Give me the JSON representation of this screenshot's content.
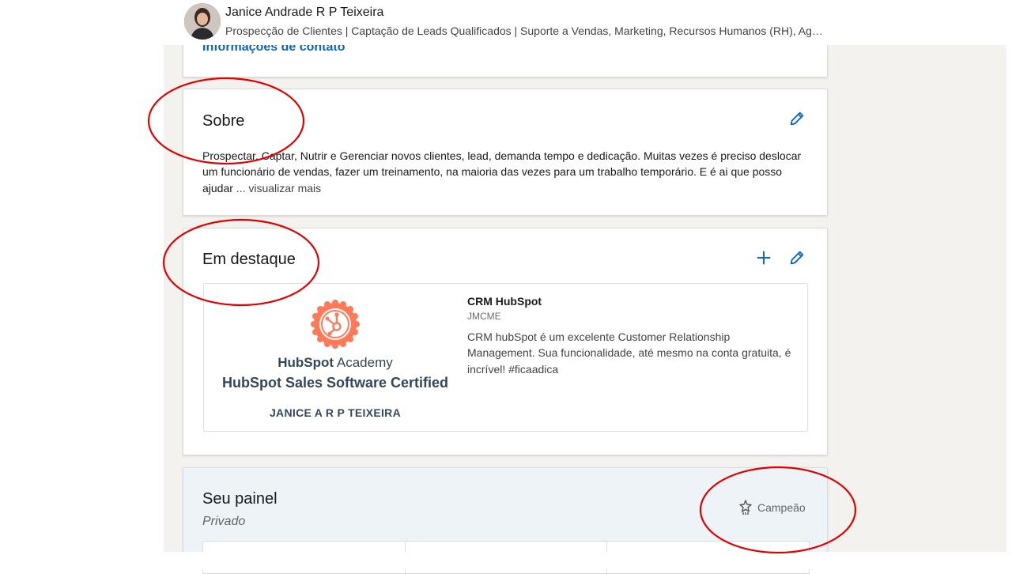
{
  "header": {
    "name": "Janice Andrade R P Teixeira",
    "headline": "Prospecção de Clientes | Captação de Leads Qualificados | Suporte a Vendas, Marketing, Recursos Humanos (RH), Agência de Marketing e Comunicação"
  },
  "contact": {
    "link_label": "Informações de contato"
  },
  "about": {
    "title": "Sobre",
    "text": "Prospectar, Captar, Nutrir e Gerenciar novos clientes, lead, demanda tempo e dedicação. Muitas vezes é preciso deslocar um funcionário de vendas, fazer um treinamento, na maioria das vezes para um trabalho temporário. E é ai que posso ajudar",
    "see_more": "... visualizar mais",
    "edit_icon": "pencil-icon"
  },
  "featured": {
    "title": "Em destaque",
    "add_icon": "plus-icon",
    "edit_icon": "pencil-icon",
    "item": {
      "title": "CRM HubSpot",
      "subtitle": "JMCME",
      "description": "CRM hubSpot é um excelente Customer Relationship Management. Sua funcionalidade, até mesmo na conta gratuita, é incrível! #ficaadica",
      "image": {
        "brand": "HubSpot",
        "academy": "Academy",
        "certification": "HubSpot Sales Software Certified",
        "holder": "JANICE A R P TEIXEIRA",
        "badge_icon": "hubspot-sprocket-icon"
      }
    }
  },
  "dashboard": {
    "title": "Seu painel",
    "subtitle": "Privado",
    "badge_label": "Campeão",
    "badge_icon": "star-icon"
  },
  "colors": {
    "link": "#0a66c2",
    "hubspot_orange": "#ff7a59",
    "hubspot_navy": "#33475b",
    "annotation_red": "#e00000",
    "dashboard_bg": "#eef3f8"
  }
}
